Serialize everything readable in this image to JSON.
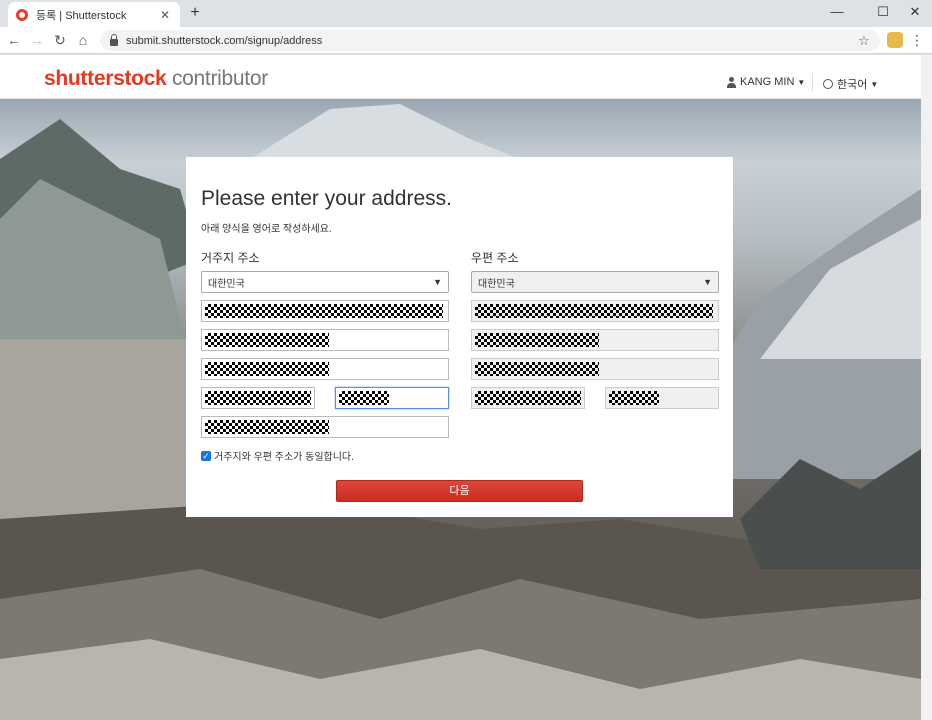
{
  "browser": {
    "tab_title": "등록 | Shutterstock",
    "url": "submit.shutterstock.com/signup/address"
  },
  "header": {
    "logo_brand": "shutterstock",
    "logo_sub": " contributor",
    "user_name": "KANG MIN",
    "language": "한국어"
  },
  "form": {
    "title": "Please enter your address.",
    "subtitle": "아래 양식을 영어로 작성하세요.",
    "residential_label": "거주지 주소",
    "mailing_label": "우편 주소",
    "residential_country": "대한민국",
    "mailing_country": "대한민국",
    "same_address_label": "거주지와 우편 주소가 동일합니다.",
    "same_address_checked": true,
    "next_button": "다음"
  },
  "colors": {
    "brand_red": "#e8381f",
    "button_red": "#d2362b",
    "checkbox_blue": "#1a73e8"
  }
}
